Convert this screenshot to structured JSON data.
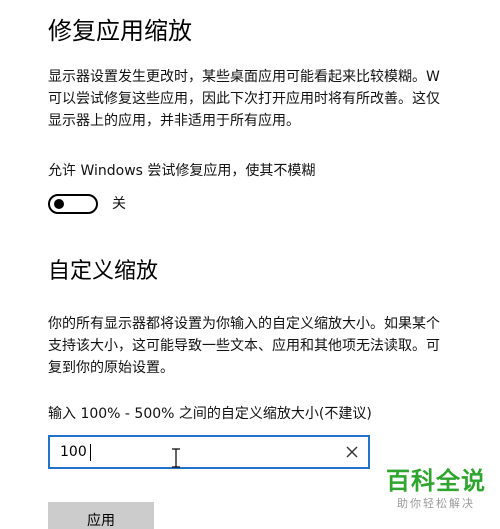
{
  "fix_scaling": {
    "title": "修复应用缩放",
    "description_lines": [
      "显示器设置发生更改时，某些桌面应用可能看起来比较模糊。W",
      "可以尝试修复这些应用，因此下次打开应用时将有所改善。这仅",
      "显示器上的应用，并非适用于所有应用。"
    ],
    "toggle_label": "允许 Windows 尝试修复应用，使其不模糊",
    "toggle_on": false,
    "toggle_state_text": "关"
  },
  "custom_scaling": {
    "title": "自定义缩放",
    "description_lines": [
      "你的所有显示器都将设置为你输入的自定义缩放大小。如果某个",
      "支持该大小，这可能导致一些文本、应用和其他项无法读取。可",
      "复到你的原始设置。"
    ],
    "input_label": "输入 100% - 500% 之间的自定义缩放大小(不建议)",
    "input_value": "100",
    "apply_label": "应用"
  },
  "watermark": {
    "title": "百科全说",
    "subtitle": "助你轻松解决"
  },
  "colors": {
    "focus_border": "#1f73c8",
    "button_bg": "#cccccc",
    "watermark_green": "#2fa52f"
  }
}
